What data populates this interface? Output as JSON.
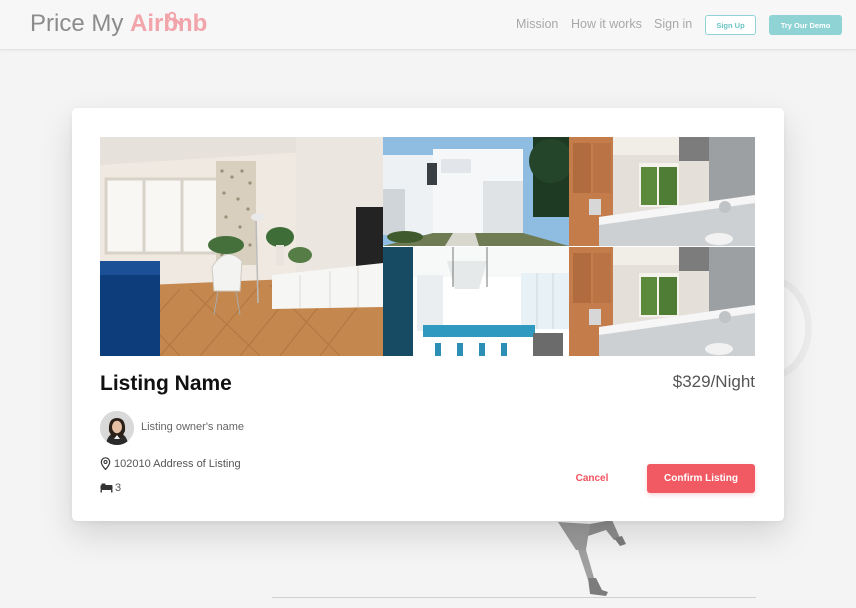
{
  "header": {
    "logo_plain": "Price My",
    "logo_brand": "Airbnb",
    "nav": [
      "Mission",
      "How it works",
      "Sign in"
    ],
    "signup_label": "Sign Up",
    "demo_label": "Try Our Demo"
  },
  "listing": {
    "name": "Listing Name",
    "price": "$329/Night",
    "owner": "Listing owner's name",
    "address": "102010 Address of Listing",
    "beds": "3"
  },
  "actions": {
    "cancel_label": "Cancel",
    "confirm_label": "Confirm Listing"
  },
  "colors": {
    "brand_pink": "#f2a4ab",
    "accent_teal": "#8fd3d4",
    "confirm_red": "#f15a62"
  },
  "icons": [
    "search-key-icon",
    "location-pin-icon",
    "bed-icon"
  ]
}
